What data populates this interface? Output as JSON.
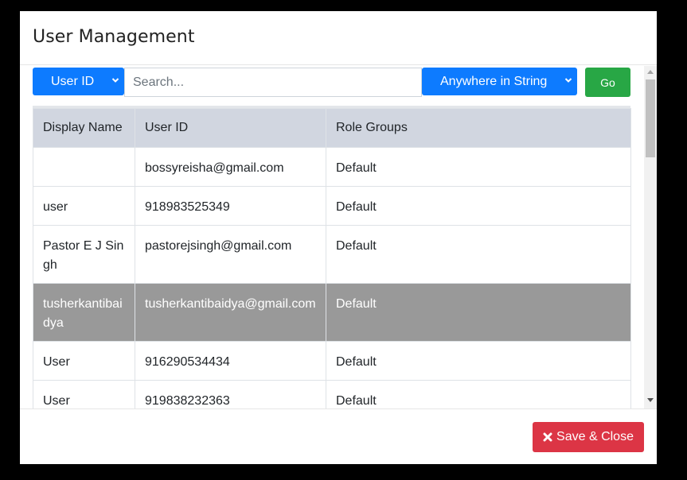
{
  "modal": {
    "title": "User Management"
  },
  "toolbar": {
    "field_select": "User ID",
    "search_placeholder": "Search...",
    "mode_select": "Anywhere in String",
    "go_label": "Go"
  },
  "table": {
    "headers": [
      "Display Name",
      "User ID",
      "Role Groups"
    ],
    "rows": [
      {
        "display_name": "",
        "user_id": "bossyreisha@gmail.com",
        "role_groups": "Default"
      },
      {
        "display_name": "user",
        "user_id": "918983525349",
        "role_groups": "Default"
      },
      {
        "display_name": "Pastor E J Singh",
        "user_id": "pastorejsingh@gmail.com",
        "role_groups": "Default"
      },
      {
        "display_name": "tusherkantibaidya",
        "user_id": "tusherkantibaidya@gmail.com",
        "role_groups": "Default"
      },
      {
        "display_name": "User",
        "user_id": "916290534434",
        "role_groups": "Default"
      },
      {
        "display_name": "User",
        "user_id": "919838232363",
        "role_groups": "Default"
      }
    ]
  },
  "footer": {
    "save_close_label": "Save & Close"
  },
  "colors": {
    "primary": "#0d7bff",
    "success": "#28a745",
    "danger": "#dc3545",
    "selected_row": "#999999",
    "header_bg": "#d1d6e0"
  },
  "icons": {
    "save": "times-icon",
    "select": "chevron-down-icon"
  }
}
